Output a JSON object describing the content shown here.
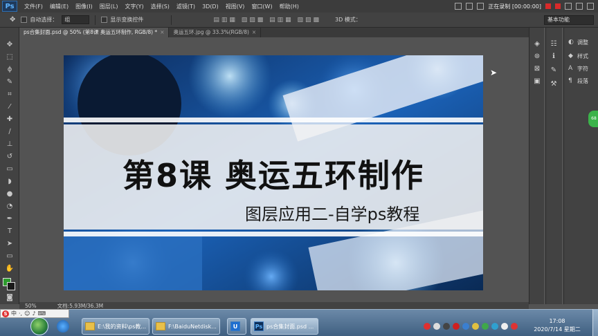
{
  "app": {
    "logo": "Ps"
  },
  "menu": [
    "文件(F)",
    "编辑(E)",
    "图像(I)",
    "图层(L)",
    "文字(Y)",
    "选择(S)",
    "滤镜(T)",
    "3D(D)",
    "视图(V)",
    "窗口(W)",
    "帮助(H)"
  ],
  "recorder": {
    "label": "正在录制 [00:00:00]"
  },
  "options": {
    "auto_select_label": "自动选择：",
    "auto_select_value": "组",
    "show_transform_label": "显示变换控件",
    "mode_3d_label": "3D 模式：",
    "workspace": "基本功能"
  },
  "tabs": [
    {
      "label": "ps合集封面.psd @ 50% (第8课  奥运五环制作, RGB/8) *",
      "close": "×"
    },
    {
      "label": "奥运五环.jpg @ 33.3%(RGB/8)",
      "close": "×"
    }
  ],
  "canvas": {
    "title": "第8课  奥运五环制作",
    "subtitle": "图层应用二-自学ps教程"
  },
  "status": {
    "zoom": "50%",
    "doc": "文档:5.93M/36.3M"
  },
  "panels": [
    {
      "label": "调整",
      "icon": "adjust-icon"
    },
    {
      "label": "样式",
      "icon": "styles-icon"
    },
    {
      "label": "字符",
      "icon": "character-icon"
    },
    {
      "label": "段落",
      "icon": "paragraph-icon"
    }
  ],
  "ime": {
    "lang": "中"
  },
  "taskbar": {
    "items": [
      {
        "label": "E:\\我的资料\\ps教...",
        "icon": "folder-icon"
      },
      {
        "label": "F:\\BaiduNetdisk...",
        "icon": "folder-icon"
      },
      {
        "label": "ps合集封面.psd ...",
        "icon": "photoshop-icon"
      }
    ],
    "time": "17:08",
    "date": "2020/7/14 星期二"
  },
  "colors": {
    "foreground": "#2d9b2d",
    "background": "#1a1a1a"
  }
}
